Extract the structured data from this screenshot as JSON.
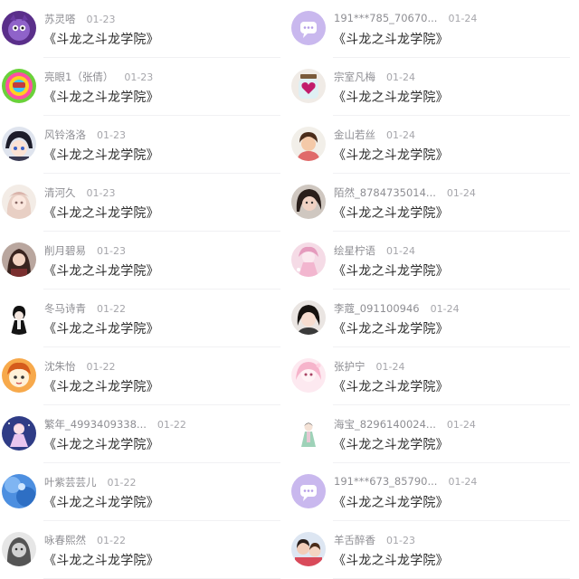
{
  "left_items": [
    {
      "name": "苏灵嗒",
      "date": "01-23",
      "message": "《斗龙之斗龙学院》",
      "avatar": "cartoon-avatar"
    },
    {
      "name": "亮眼1（张倩）",
      "date": "01-23",
      "message": "《斗龙之斗龙学院》",
      "avatar": "toy-avatar"
    },
    {
      "name": "风铃洛洛",
      "date": "01-23",
      "message": "《斗龙之斗龙学院》",
      "avatar": "anime-avatar"
    },
    {
      "name": "清河久",
      "date": "01-23",
      "message": "《斗龙之斗龙学院》",
      "avatar": "anime-avatar"
    },
    {
      "name": "削月碧易",
      "date": "01-23",
      "message": "《斗龙之斗龙学院》",
      "avatar": "anime-avatar"
    },
    {
      "name": "冬马诗青",
      "date": "01-22",
      "message": "《斗龙之斗龙学院》",
      "avatar": "anime-avatar"
    },
    {
      "name": "沈朱怡",
      "date": "01-22",
      "message": "《斗龙之斗龙学院》",
      "avatar": "cartoon-avatar"
    },
    {
      "name": "繁年_4993409338...",
      "date": "01-22",
      "message": "《斗龙之斗龙学院》",
      "avatar": "anime-avatar"
    },
    {
      "name": "叶紫芸芸儿",
      "date": "01-22",
      "message": "《斗龙之斗龙学院》",
      "avatar": "sky-avatar"
    },
    {
      "name": "咏春熙然",
      "date": "01-22",
      "message": "《斗龙之斗龙学院》",
      "avatar": "photo-avatar"
    }
  ],
  "right_items": [
    {
      "name": "191***785_70670...",
      "date": "01-24",
      "message": "《斗龙之斗龙学院》",
      "avatar": "default-chat-avatar"
    },
    {
      "name": "宗室凡梅",
      "date": "01-24",
      "message": "《斗龙之斗龙学院》",
      "avatar": "heart-jar-avatar"
    },
    {
      "name": "金山若丝",
      "date": "01-24",
      "message": "《斗龙之斗龙学院》",
      "avatar": "photo-avatar"
    },
    {
      "name": "陌然_8784735014...",
      "date": "01-24",
      "message": "《斗龙之斗龙学院》",
      "avatar": "photo-avatar"
    },
    {
      "name": "绘星柠语",
      "date": "01-24",
      "message": "《斗龙之斗龙学院》",
      "avatar": "anime-avatar"
    },
    {
      "name": "李蔻_091100946",
      "date": "01-24",
      "message": "《斗龙之斗龙学院》",
      "avatar": "photo-avatar"
    },
    {
      "name": "张护宁",
      "date": "01-24",
      "message": "《斗龙之斗龙学院》",
      "avatar": "anime-avatar"
    },
    {
      "name": "海宝_8296140024...",
      "date": "01-24",
      "message": "《斗龙之斗龙学院》",
      "avatar": "anime-avatar"
    },
    {
      "name": "191***673_85790...",
      "date": "01-24",
      "message": "《斗龙之斗龙学院》",
      "avatar": "default-chat-avatar"
    },
    {
      "name": "羊舌醉香",
      "date": "01-23",
      "message": "《斗龙之斗龙学院》",
      "avatar": "photo-avatar"
    }
  ]
}
